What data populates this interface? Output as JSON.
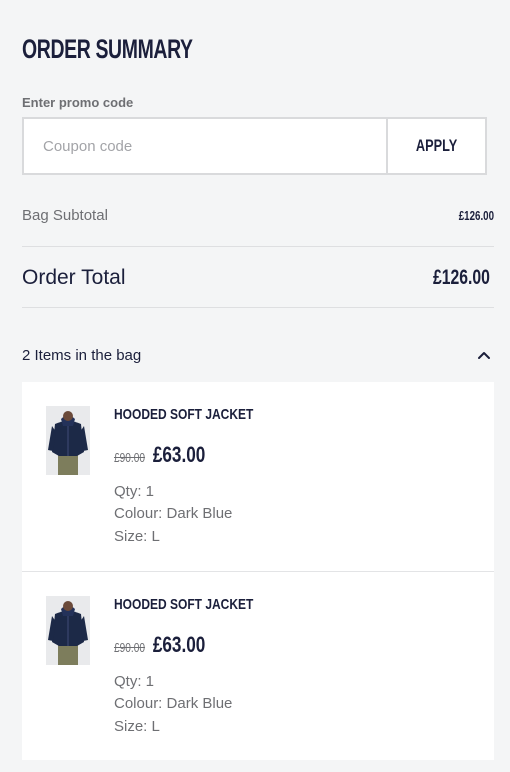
{
  "summary": {
    "title": "ORDER SUMMARY"
  },
  "promo": {
    "label": "Enter promo code",
    "placeholder": "Coupon code",
    "value": "",
    "apply_label": "APPLY"
  },
  "totals": {
    "subtotal_label": "Bag Subtotal",
    "subtotal_value": "£126.00",
    "total_label": "Order Total",
    "total_value": "£126.00"
  },
  "bag": {
    "label": "2 Items in the bag",
    "expanded_icon": "chevron-up-icon",
    "items": [
      {
        "name": "HOODED SOFT JACKET",
        "original_price": "£90.00",
        "sale_price": "£63.00",
        "qty": "Qty: 1",
        "colour": "Colour: Dark Blue",
        "size": "Size: L"
      },
      {
        "name": "HOODED SOFT JACKET",
        "original_price": "£90.00",
        "sale_price": "£63.00",
        "qty": "Qty: 1",
        "colour": "Colour: Dark Blue",
        "size": "Size: L"
      }
    ]
  },
  "colors": {
    "text_primary": "#1b1f3b",
    "text_muted": "#6e6f73",
    "page_background": "#f4f5f6",
    "card_background": "#ffffff",
    "jacket": "#1c2947",
    "trousers": "#7d7d5c"
  }
}
